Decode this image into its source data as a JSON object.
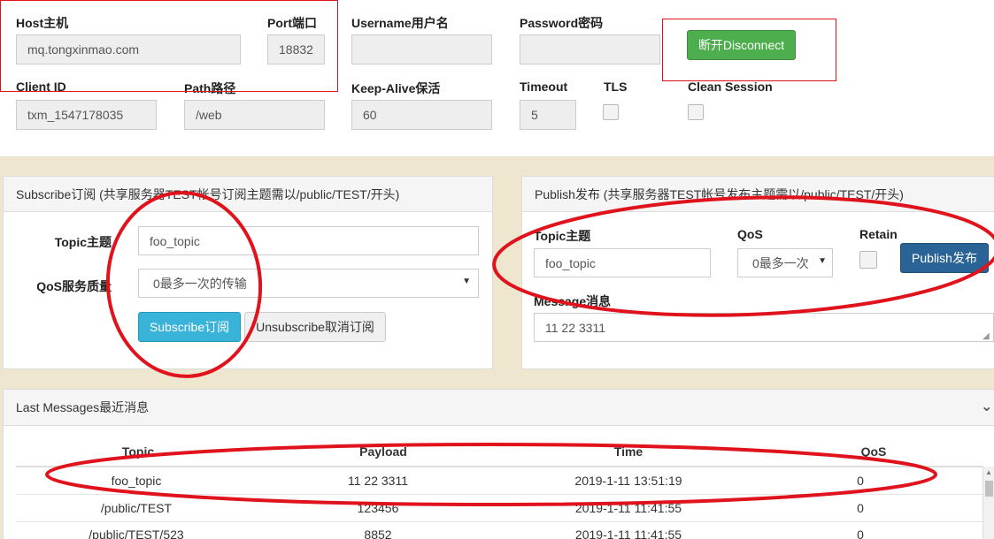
{
  "connection": {
    "host_label": "Host主机",
    "host_value": "mq.tongxinmao.com",
    "port_label": "Port端口",
    "port_value": "18832",
    "username_label": "Username用户名",
    "username_value": "",
    "password_label": "Password密码",
    "password_value": "",
    "disconnect_label": "断开Disconnect",
    "clientid_label": "Client ID",
    "clientid_value": "txm_1547178035",
    "path_label": "Path路径",
    "path_value": "/web",
    "keepalive_label": "Keep-Alive保活",
    "keepalive_value": "60",
    "timeout_label": "Timeout",
    "timeout_value": "5",
    "tls_label": "TLS",
    "clean_label": "Clean Session"
  },
  "subscribe": {
    "header": "Subscribe订阅 (共享服务器TEST帐号订阅主题需以/public/TEST/开头)",
    "topic_label": "Topic主题",
    "topic_value": "foo_topic",
    "qos_label": "QoS服务质量",
    "qos_value": "0最多一次的传输",
    "subscribe_label": "Subscribe订阅",
    "unsubscribe_label": "Unsubscribe取消订阅"
  },
  "publish": {
    "header": "Publish发布 (共享服务器TEST帐号发布主题需以/public/TEST/开头)",
    "topic_label": "Topic主题",
    "topic_value": "foo_topic",
    "qos_label": "QoS",
    "qos_value": "0最多一次",
    "retain_label": "Retain",
    "publish_label": "Publish发布",
    "message_label": "Message消息",
    "message_value": "11 22 3311"
  },
  "messages": {
    "header": "Last Messages最近消息",
    "columns": [
      "Topic",
      "Payload",
      "Time",
      "QoS"
    ],
    "rows": [
      [
        "foo_topic",
        "11 22 3311",
        "2019-1-11 13:51:19",
        "0"
      ],
      [
        "/public/TEST",
        "123456",
        "2019-1-11 11:41:55",
        "0"
      ],
      [
        "/public/TEST/523",
        "8852",
        "2019-1-11 11:41:55",
        "0"
      ]
    ]
  },
  "colors": {
    "background": "#efe6cf",
    "disconnect": "#4cae4c",
    "subscribe": "#39b3d7",
    "publish": "#2a6496",
    "annotation": "#e0121c"
  },
  "icons": [
    "chevron-down-icon",
    "caret-down-icon",
    "resize-grip-icon"
  ]
}
